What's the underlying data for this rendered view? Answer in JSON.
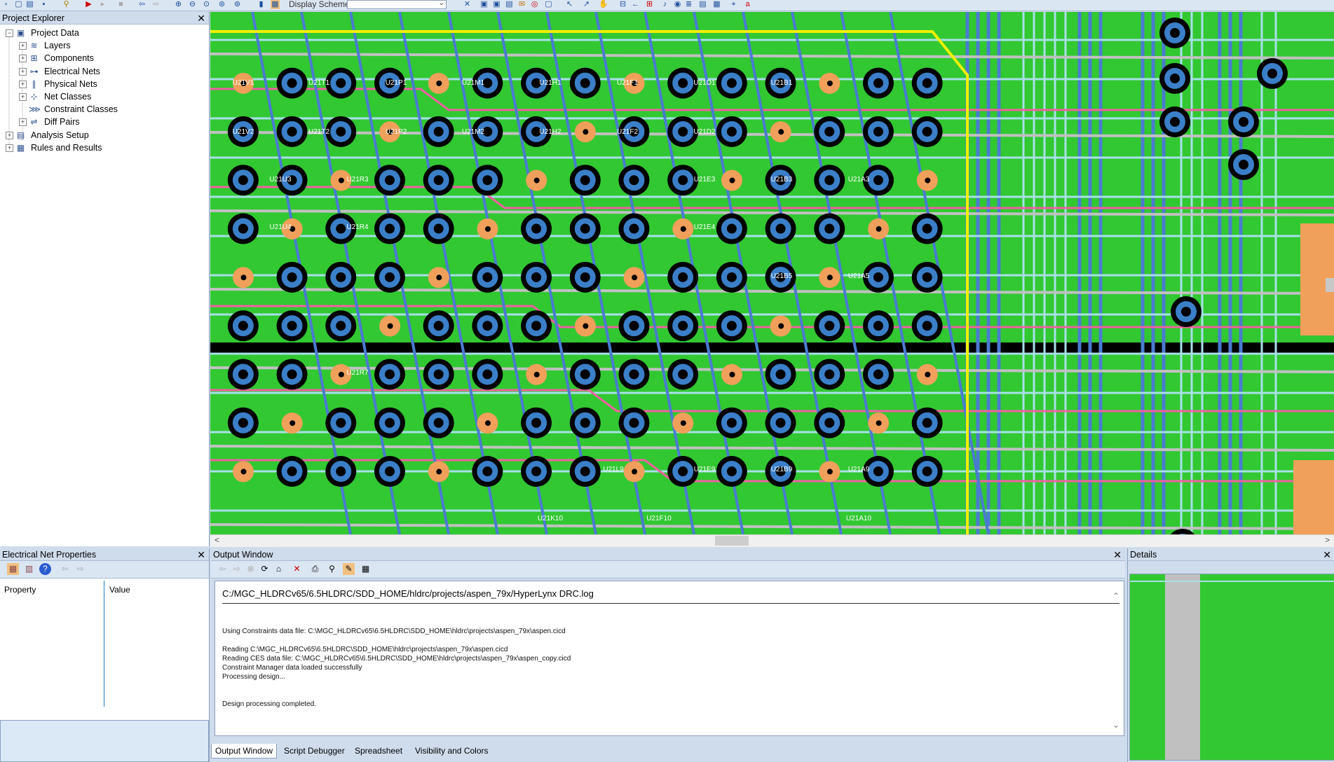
{
  "colors": {
    "board": "#32c832",
    "pad": "#f0a05a",
    "via_ring": "#3a7fc8",
    "via_hole": "#000000",
    "trace_blue": "#4a7bd0",
    "trace_light": "#a8e0e8",
    "trace_pink": "#f060a0",
    "trace_gray": "#c0c0c0",
    "trace_yellow": "#f0f000"
  },
  "toolbar": {
    "display_scheme_label": "Display Scheme",
    "display_scheme_value": ""
  },
  "project_explorer": {
    "title": "Project Explorer",
    "tree": [
      {
        "label": "Project Data",
        "icon": "computer-icon",
        "level": 0
      },
      {
        "label": "Layers",
        "icon": "layers-icon",
        "level": 1
      },
      {
        "label": "Components",
        "icon": "component-icon",
        "level": 1
      },
      {
        "label": "Electrical Nets",
        "icon": "electrical-net-icon",
        "level": 1
      },
      {
        "label": "Physical Nets",
        "icon": "physical-net-icon",
        "level": 1
      },
      {
        "label": "Net Classes",
        "icon": "net-class-icon",
        "level": 1
      },
      {
        "label": "Constraint Classes",
        "icon": "constraint-class-icon",
        "level": 1
      },
      {
        "label": "Diff Pairs",
        "icon": "diff-pair-icon",
        "level": 1
      },
      {
        "label": "Analysis Setup",
        "icon": "analysis-setup-icon",
        "level": 0
      },
      {
        "label": "Rules and Results",
        "icon": "rules-results-icon",
        "level": 0
      }
    ]
  },
  "electrical_net_properties": {
    "title": "Electrical Net Properties",
    "col_property": "Property",
    "col_value": "Value"
  },
  "output_window": {
    "title": "Output Window",
    "log_path": "C:/MGC_HLDRCv65/6.5HLDRC/SDD_HOME/hldrc/projects/aspen_79x/HyperLynx DRC.log",
    "lines": [
      "Using Constraints data file: C:\\MGC_HLDRCv65\\6.5HLDRC\\SDD_HOME\\hldrc\\projects\\aspen_79x\\aspen.cicd",
      "",
      "Reading C:\\MGC_HLDRCv65\\6.5HLDRC\\SDD_HOME\\hldrc\\projects\\aspen_79x\\aspen.cicd",
      "Reading CES data file: C:\\MGC_HLDRCv65\\6.5HLDRC\\SDD_HOME\\hldrc\\projects\\aspen_79x\\aspen_copy.cicd",
      "Constraint Manager data loaded successfully",
      "Processing design...",
      "",
      "",
      "Design processing completed."
    ],
    "tabs": [
      "Output Window",
      "Script Debugger",
      "Spreadsheet",
      "Visibility and Colors"
    ]
  },
  "details": {
    "title": "Details"
  },
  "pad_labels": {
    "row1": [
      "U21V1",
      "U21T1",
      "U21P1",
      "U21M1",
      "U21H1",
      "U21F1",
      "U21D1",
      "U21B1"
    ],
    "row2": [
      "U21V2",
      "U21T2",
      "U21P2",
      "U21M2",
      "U21H2",
      "U21F2",
      "U21D2"
    ],
    "row3": [
      "U21U3",
      "U21R3",
      "U21E3",
      "U21B3",
      "U21A3"
    ],
    "row4": [
      "U21U4",
      "U21R4",
      "U21E4"
    ],
    "row5": [
      "U21B5",
      "U21A5"
    ],
    "row7": [
      "U21R7"
    ],
    "row9": [
      "U21L9",
      "U21E9",
      "U21B9",
      "U21A9"
    ],
    "row10": [
      "U21K10",
      "U21F10",
      "U21A10"
    ]
  }
}
